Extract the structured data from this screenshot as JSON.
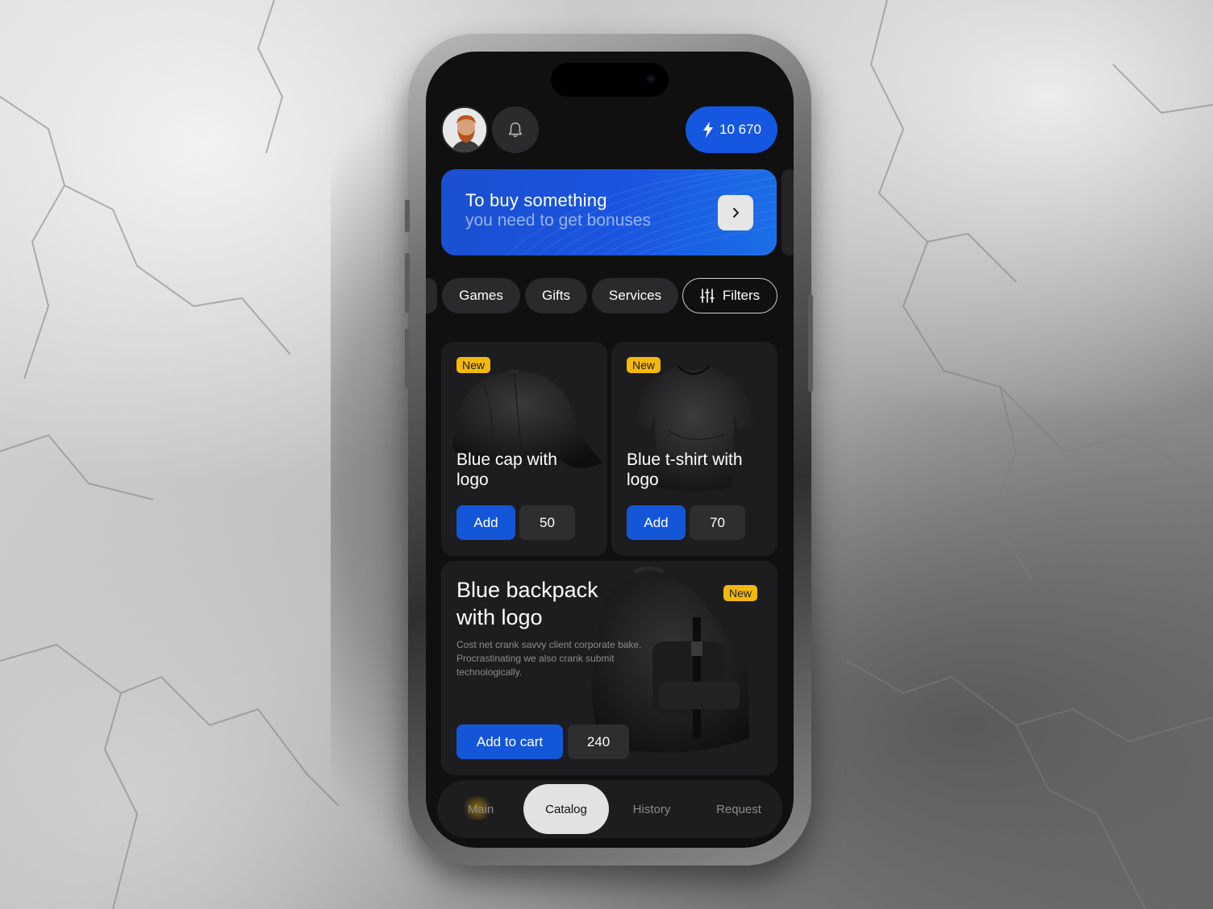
{
  "header": {
    "points": "10 670"
  },
  "banner": {
    "title": "To buy something",
    "subtitle": "you need to get bonuses"
  },
  "chips": {
    "games": "Games",
    "gifts": "Gifts",
    "services": "Services",
    "filters": "Filters"
  },
  "products": [
    {
      "badge": "New",
      "title_line1": "Blue cap with",
      "title_line2": "logo",
      "button": "Add",
      "price": "50"
    },
    {
      "badge": "New",
      "title_line1": "Blue t-shirt with",
      "title_line2": "logo",
      "button": "Add",
      "price": "70"
    }
  ],
  "featured": {
    "badge": "New",
    "title_line1": "Blue backpack",
    "title_line2": "with logo",
    "desc_line1": "Cost net crank savvy client corporate bake.",
    "desc_line2": "Procrastinating we also crank submit",
    "desc_line3": "technologically.",
    "button": "Add to cart",
    "price": "240"
  },
  "tabs": {
    "main": "Main",
    "catalog": "Catalog",
    "history": "History",
    "request": "Request",
    "active": "catalog"
  },
  "colors": {
    "accent": "#1557e0",
    "badge": "#f2b90c",
    "card": "#1d1d1f",
    "screen": "#101011"
  },
  "icons": [
    "bell-icon",
    "lightning-icon",
    "chevron-right-icon",
    "sliders-icon"
  ]
}
